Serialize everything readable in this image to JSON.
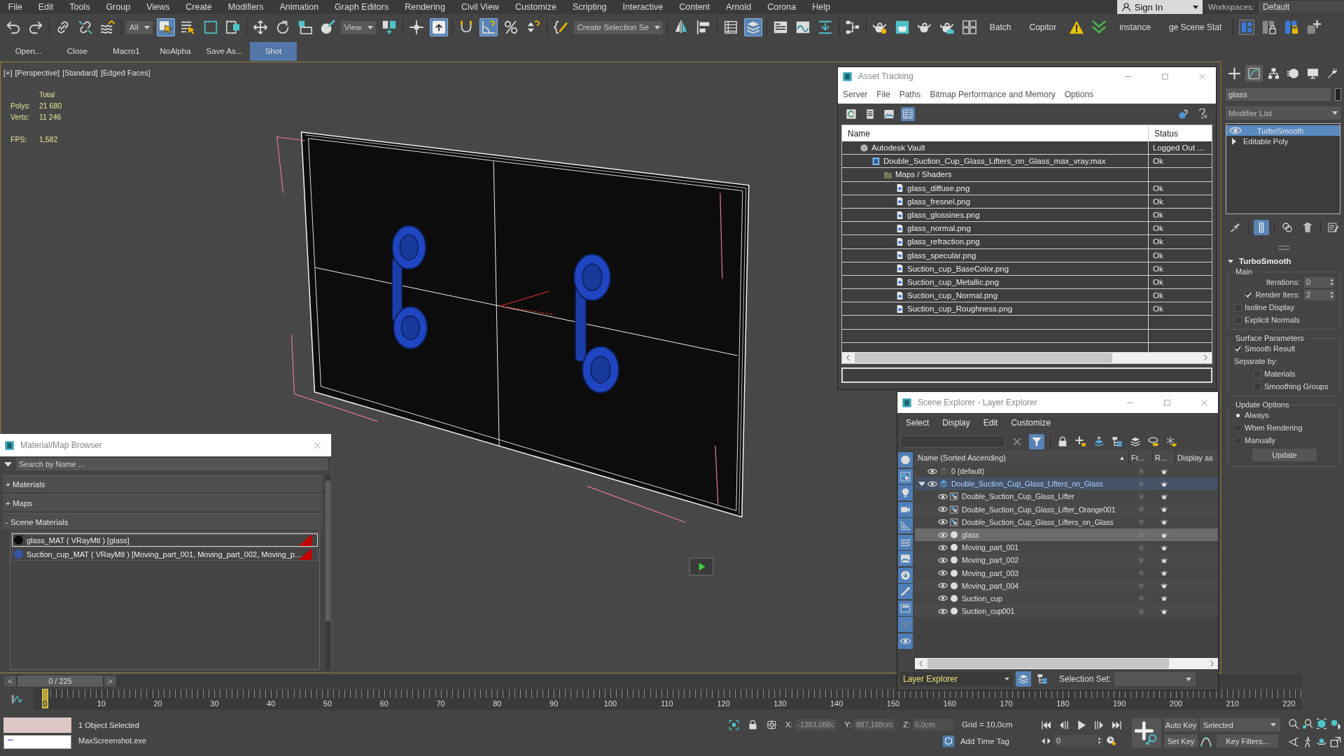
{
  "menu_bar": {
    "items": [
      "File",
      "Edit",
      "Tools",
      "Group",
      "Views",
      "Create",
      "Modifiers",
      "Animation",
      "Graph Editors",
      "Rendering",
      "Civil View",
      "Customize",
      "Scripting",
      "Interactive",
      "Content",
      "Arnold",
      "Corona",
      "Help"
    ],
    "sign_in": "Sign In",
    "workspaces_label": "Workspaces:",
    "workspace": "Default"
  },
  "main_toolbar": {
    "items": [
      {
        "kind": "icon",
        "selected": false
      },
      {
        "kind": "icon",
        "selected": false
      },
      {
        "kind": "icon",
        "selected": false
      },
      {
        "kind": "icon",
        "selected": false
      },
      {
        "kind": "icon",
        "selected": false
      },
      {
        "kind": "dropdown",
        "value": "All"
      },
      {
        "kind": "icon",
        "selected": true
      },
      {
        "kind": "icon",
        "selected": false
      },
      {
        "kind": "icon",
        "selected": false
      },
      {
        "kind": "icon",
        "selected": false
      },
      {
        "kind": "icon",
        "selected": false
      },
      {
        "kind": "icon",
        "selected": false
      },
      {
        "kind": "icon",
        "selected": false
      },
      {
        "kind": "icon",
        "selected": false
      },
      {
        "kind": "dropdown",
        "value": "View"
      },
      {
        "kind": "icon",
        "selected": false
      },
      {
        "kind": "icon",
        "selected": false
      },
      {
        "kind": "icon",
        "selected": true
      },
      {
        "kind": "icon",
        "selected": false
      },
      {
        "kind": "icon",
        "selected": true
      },
      {
        "kind": "icon",
        "selected": false
      },
      {
        "kind": "icon",
        "selected": false
      },
      {
        "kind": "icon",
        "selected": false
      },
      {
        "kind": "dropdown",
        "value": "Create Selection Se"
      },
      {
        "kind": "icon",
        "selected": false
      },
      {
        "kind": "icon",
        "selected": false
      },
      {
        "kind": "icon",
        "selected": false
      },
      {
        "kind": "icon",
        "selected": true
      },
      {
        "kind": "icon",
        "selected": false
      },
      {
        "kind": "icon",
        "selected": false
      },
      {
        "kind": "icon",
        "selected": false
      },
      {
        "kind": "icon",
        "selected": false
      },
      {
        "kind": "icon",
        "selected": false
      },
      {
        "kind": "icon",
        "selected": false
      },
      {
        "kind": "icon",
        "selected": false
      },
      {
        "kind": "icon",
        "selected": false
      },
      {
        "kind": "icon",
        "selected": false
      },
      {
        "kind": "text",
        "label": "Batch"
      },
      {
        "kind": "text",
        "label": "Copitor"
      },
      {
        "kind": "icon",
        "selected": false
      },
      {
        "kind": "icon",
        "selected": false
      },
      {
        "kind": "text",
        "label": "instance"
      },
      {
        "kind": "text",
        "label": "ge Scene Stat"
      },
      {
        "kind": "icon",
        "selected": false
      },
      {
        "kind": "icon",
        "selected": false
      },
      {
        "kind": "icon",
        "selected": false
      },
      {
        "kind": "icon",
        "selected": false
      }
    ]
  },
  "macro_toolbar": {
    "buttons": [
      {
        "label": "Open...",
        "selected": false
      },
      {
        "label": "Close",
        "selected": false
      },
      {
        "label": "Macro1",
        "selected": false
      },
      {
        "label": "NoAlpha",
        "selected": false
      },
      {
        "label": "Save As...",
        "selected": false
      },
      {
        "label": "Shot",
        "selected": true
      }
    ]
  },
  "viewport": {
    "labels": [
      "[+]",
      "[Perspective]",
      "[Standard]",
      "[Edged Faces]"
    ],
    "stats": {
      "heading": "Total",
      "rows": [
        {
          "label": "Polys:",
          "value": "21 680"
        },
        {
          "label": "Verts:",
          "value": "11 246"
        }
      ],
      "fps_label": "FPS:",
      "fps": "1,582"
    }
  },
  "command_panel": {
    "tabs": [
      {
        "selected": false
      },
      {
        "selected": true
      },
      {
        "selected": false
      },
      {
        "selected": false
      },
      {
        "selected": false
      },
      {
        "selected": false
      }
    ],
    "object_name": "glass",
    "modifier_list": "Modifier List",
    "stack": [
      {
        "kind": "modifier",
        "name": "TurboSmooth",
        "enabled": true,
        "selected": true
      },
      {
        "kind": "base",
        "name": "Editable Poly",
        "expanded": false,
        "selected": false
      }
    ],
    "stack_tools": [
      {
        "selected": false
      },
      {
        "selected": true
      },
      {
        "selected": false
      },
      {
        "selected": false
      },
      {
        "selected": false
      }
    ],
    "rollout": {
      "title": "TurboSmooth",
      "groups": [
        {
          "title": "Main",
          "controls": [
            {
              "kind": "spinner",
              "label": "Iterations:",
              "value": "0"
            },
            {
              "kind": "check_spinner",
              "label": "Render Iters:",
              "checked": true,
              "value": "2"
            },
            {
              "kind": "checkbox",
              "label": "Isoline Display",
              "checked": false
            },
            {
              "kind": "checkbox",
              "label": "Explicit Normals",
              "checked": false
            }
          ]
        },
        {
          "title": "Surface Parameters",
          "controls": [
            {
              "kind": "checkbox",
              "label": "Smooth Result",
              "checked": true
            },
            {
              "kind": "label",
              "label": "Separate by:",
              "children": [
                {
                  "kind": "checkbox",
                  "label": "Materials",
                  "checked": false
                },
                {
                  "kind": "checkbox",
                  "label": "Smoothing Groups",
                  "checked": false
                }
              ]
            }
          ]
        },
        {
          "title": "Update Options",
          "controls": [
            {
              "kind": "radio",
              "label": "Always",
              "selected": true
            },
            {
              "kind": "radio",
              "label": "When Rendering",
              "selected": false
            },
            {
              "kind": "radio",
              "label": "Manually",
              "selected": false
            },
            {
              "kind": "button",
              "label": "Update"
            }
          ]
        }
      ]
    }
  },
  "asset_tracking": {
    "title": "Asset Tracking",
    "menu": [
      "Server",
      "File",
      "Paths",
      "Bitmap Performance and Memory",
      "Options"
    ],
    "toolbar": [
      {
        "selected": false
      },
      {
        "selected": false
      },
      {
        "selected": false
      },
      {
        "selected": true
      }
    ],
    "columns": [
      "Name",
      "Status"
    ],
    "tree": [
      {
        "kind": "vault",
        "name": "Autodesk Vault",
        "status": "Logged Out ...",
        "children": [
          {
            "kind": "scene",
            "name": "Double_Suction_Cup_Glass_Lifters_on_Glass_max_vray.max",
            "status": "Ok",
            "children": [
              {
                "kind": "folder",
                "name": "Maps / Shaders",
                "children": [
                  {
                    "kind": "file",
                    "name": "glass_diffuse.png",
                    "status": "Ok"
                  },
                  {
                    "kind": "file",
                    "name": "glass_fresnel.png",
                    "status": "Ok"
                  },
                  {
                    "kind": "file",
                    "name": "glass_glossines.png",
                    "status": "Ok"
                  },
                  {
                    "kind": "file",
                    "name": "glass_normal.png",
                    "status": "Ok"
                  },
                  {
                    "kind": "file",
                    "name": "glass_refraction.png",
                    "status": "Ok"
                  },
                  {
                    "kind": "file",
                    "name": "glass_specular.png",
                    "status": "Ok"
                  },
                  {
                    "kind": "file",
                    "name": "Suction_cup_BaseColor.png",
                    "status": "Ok"
                  },
                  {
                    "kind": "file",
                    "name": "Suction_cup_Metallic.png",
                    "status": "Ok"
                  },
                  {
                    "kind": "file",
                    "name": "Suction_cup_Normal.png",
                    "status": "Ok"
                  },
                  {
                    "kind": "file",
                    "name": "Suction_cup_Roughness.png",
                    "status": "Ok"
                  }
                ]
              }
            ]
          }
        ]
      }
    ]
  },
  "scene_explorer": {
    "title": "Scene Explorer - Layer Explorer",
    "menu": [
      "Select",
      "Display",
      "Edit",
      "Customize"
    ],
    "toolbar": [
      {
        "selected": false
      },
      {
        "selected": true
      },
      {
        "selected": false
      },
      {
        "selected": false
      },
      {
        "selected": false
      },
      {
        "selected": false
      },
      {
        "selected": false
      },
      {
        "selected": false
      },
      {
        "selected": false
      }
    ],
    "display_filters": [
      {
        "on": true
      },
      {
        "on": true
      },
      {
        "on": true
      },
      {
        "on": true
      },
      {
        "on": true
      },
      {
        "on": true
      },
      {
        "on": true
      },
      {
        "on": true
      },
      {
        "on": true
      },
      {
        "on": true
      },
      {
        "on": true
      },
      {
        "on": true
      }
    ],
    "columns": [
      "Name (Sorted Ascending)",
      "Fr...",
      "R...",
      "Display as"
    ],
    "layers": [
      {
        "kind": "layer",
        "name": "0 (default)",
        "active": false
      },
      {
        "kind": "layer",
        "name": "Double_Suction_Cup_Glass_Lifters_on_Glass",
        "active": true,
        "expanded": true,
        "children": [
          {
            "kind": "group",
            "name": "Double_Suction_Cup_Glass_Lifter",
            "selected": false
          },
          {
            "kind": "group",
            "name": "Double_Suction_Cup_Glass_Lifter_Orange001",
            "selected": false
          },
          {
            "kind": "group",
            "name": "Double_Suction_Cup_Glass_Lifters_on_Glass",
            "selected": false
          },
          {
            "kind": "object",
            "name": "glass",
            "selected": true
          },
          {
            "kind": "object",
            "name": "Moving_part_001",
            "selected": false
          },
          {
            "kind": "object",
            "name": "Moving_part_002",
            "selected": false
          },
          {
            "kind": "object",
            "name": "Moving_part_003",
            "selected": false
          },
          {
            "kind": "object",
            "name": "Moving_part_004",
            "selected": false
          },
          {
            "kind": "object",
            "name": "Suction_cup",
            "selected": false
          },
          {
            "kind": "object",
            "name": "Suction_cup001",
            "selected": false
          }
        ]
      }
    ],
    "explorer": "Layer Explorer",
    "modes": [
      {
        "selected": true
      },
      {
        "selected": false
      }
    ],
    "selection_set_label": "Selection Set:"
  },
  "material_browser": {
    "title": "Material/Map Browser",
    "search_placeholder": "Search by Name ...",
    "groups": [
      {
        "toggle": "+",
        "label": "Materials"
      },
      {
        "toggle": "+",
        "label": "Maps"
      },
      {
        "toggle": "-",
        "label": "Scene Materials",
        "items": [
          {
            "name": "glass_MAT ( VRayMtl ) [glass]",
            "color": "#0a0a0a",
            "selected": true
          },
          {
            "name": "Suction_cup_MAT ( VRayMtl ) [Moving_part_001, Moving_part_002, Moving_p...",
            "color": "#3a55a5",
            "selected": false
          }
        ]
      }
    ]
  },
  "time_slider": {
    "prev": "<",
    "position": "0 / 225",
    "next": ">",
    "level": 0
  },
  "track_bar": {
    "labels": [
      "0",
      "10",
      "20",
      "30",
      "40",
      "50",
      "60",
      "70",
      "80",
      "90",
      "100",
      "110",
      "120",
      "130",
      "140",
      "150",
      "160",
      "170",
      "180",
      "190",
      "200",
      "210",
      "220"
    ]
  },
  "status_bar": {
    "listener_output": "\"\"",
    "selection": "1 Object Selected",
    "prompt": "MaxScreenshot.exe",
    "coordinates": [
      {
        "label": "X:",
        "value": "-1383,088c",
        "disabled": true
      },
      {
        "label": "Y:",
        "value": "887,188cm",
        "disabled": true
      },
      {
        "label": "Z:",
        "value": "0,0cm",
        "disabled": true
      }
    ],
    "grid": "Grid = 10,0cm",
    "time_tag": "Add Time Tag",
    "frame": "0",
    "auto_key": "Auto Key",
    "key_mode": "Selected",
    "set_key": "Set Key",
    "key_filters": "Key Filters..."
  }
}
